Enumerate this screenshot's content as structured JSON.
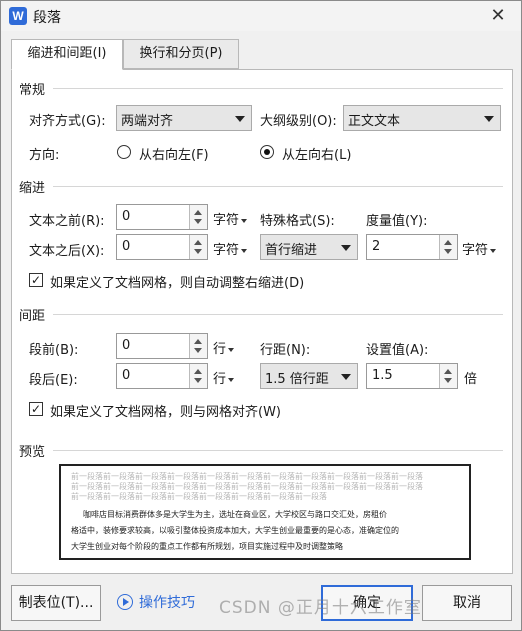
{
  "window": {
    "title": "段落",
    "app_icon": "wps-writer-icon"
  },
  "tabs": [
    {
      "label": "缩进和间距(I)",
      "active": true
    },
    {
      "label": "换行和分页(P)",
      "active": false
    }
  ],
  "general": {
    "heading": "常规",
    "alignment": {
      "label": "对齐方式(G):",
      "value": "两端对齐"
    },
    "outline_level": {
      "label": "大纲级别(O):",
      "value": "正文文本"
    },
    "direction": {
      "label": "方向:",
      "options": [
        {
          "label": "从右向左(F)",
          "checked": false
        },
        {
          "label": "从左向右(L)",
          "checked": true
        }
      ]
    }
  },
  "indent": {
    "heading": "缩进",
    "before_text": {
      "label": "文本之前(R):",
      "value": "0",
      "unit": "字符"
    },
    "after_text": {
      "label": "文本之后(X):",
      "value": "0",
      "unit": "字符"
    },
    "special": {
      "label": "特殊格式(S):",
      "value": "首行缩进"
    },
    "measure": {
      "label": "度量值(Y):",
      "value": "2",
      "unit": "字符"
    },
    "auto_adjust": {
      "label": "如果定义了文档网格，则自动调整右缩进(D)",
      "checked": true
    }
  },
  "spacing": {
    "heading": "间距",
    "before": {
      "label": "段前(B):",
      "value": "0",
      "unit": "行"
    },
    "after": {
      "label": "段后(E):",
      "value": "0",
      "unit": "行"
    },
    "line_spacing": {
      "label": "行距(N):",
      "value": "1.5 倍行距"
    },
    "set_value": {
      "label": "设置值(A):",
      "value": "1.5",
      "unit": "倍"
    },
    "snap_grid": {
      "label": "如果定义了文档网格，则与网格对齐(W)",
      "checked": true
    }
  },
  "preview": {
    "heading": "预览",
    "prev_lines": [
      "前一段落前一段落前一段落前一段落前一段落前一段落前一段落前一段落前一段落前一段落前一段落",
      "前一段落前一段落前一段落前一段落前一段落前一段落前一段落前一段落前一段落前一段落前一段落",
      "前一段落前一段落前一段落前一段落前一段落前一段落前一段落前一段落"
    ],
    "body_lines": [
      "咖啡店目标消费群体多是大学生为主，选址在商业区，大学校区与路口交汇处，房租价",
      "格适中，装修要求较高，以吸引整体投资成本加大，大学生创业最重要的是心态，准确定位的",
      "大学生创业对每个阶段的重点工作都有所规划，项目实施过程中及时调整策略"
    ]
  },
  "buttons": {
    "tabs_button": "制表位(T)...",
    "help_link": "操作技巧",
    "ok": "确定",
    "cancel": "取消"
  },
  "watermark": "CSDN @正月十六工作室"
}
